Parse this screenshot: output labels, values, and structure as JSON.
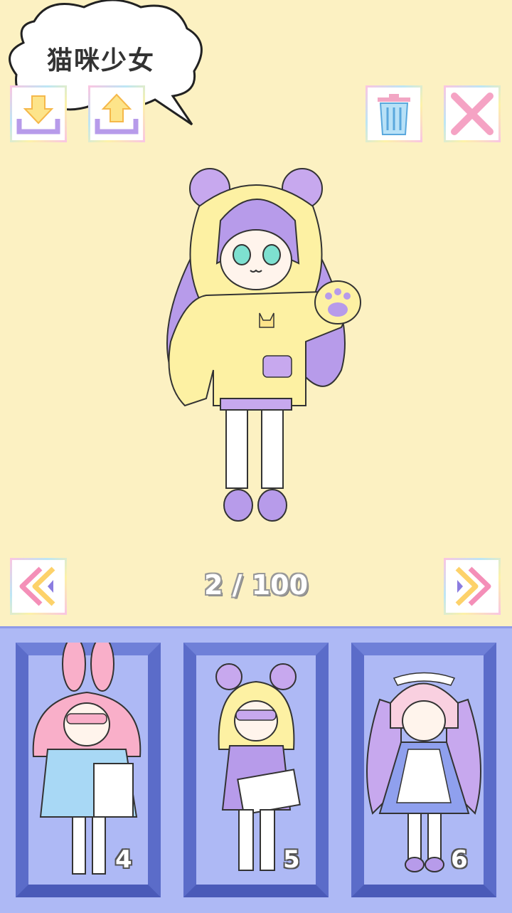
{
  "outfit_name": "猫咪少女",
  "pager": {
    "current": 2,
    "total": 100,
    "label": "2 / 100"
  },
  "toolbar": {
    "download": "download-icon",
    "upload": "upload-icon",
    "delete": "trash-icon",
    "close": "close-icon"
  },
  "slots": [
    {
      "number": "4",
      "character": "bunny-hood-girl"
    },
    {
      "number": "5",
      "character": "bear-hood-girl"
    },
    {
      "number": "6",
      "character": "maid-girl"
    }
  ],
  "colors": {
    "background": "#FCF1C2",
    "tray": "#AEB9F5",
    "frame": "#5B6CC9",
    "accent_purple": "#B79BEA",
    "accent_yellow": "#FDF1A3"
  }
}
